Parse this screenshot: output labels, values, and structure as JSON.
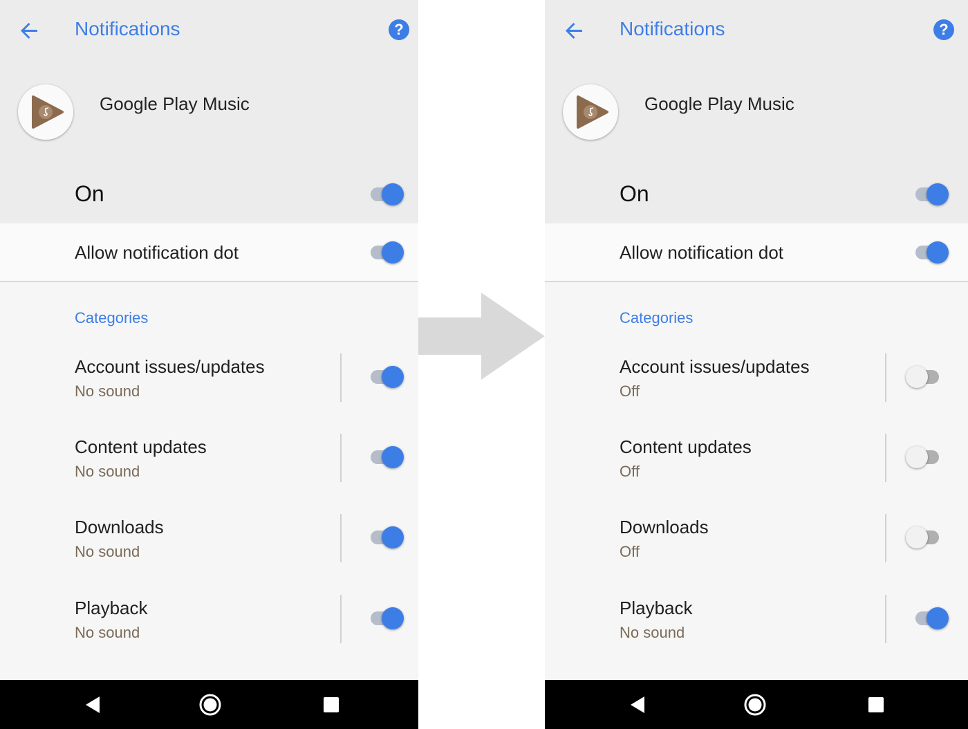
{
  "colors": {
    "accent": "#3d7de6",
    "header_bg": "#ececec",
    "subtext": "#7a6a58"
  },
  "screens": [
    {
      "title": "Notifications",
      "help_glyph": "?",
      "app_name": "Google Play Music",
      "master_label": "On",
      "master_on": true,
      "dot_label": "Allow notification dot",
      "dot_on": true,
      "categories_header": "Categories",
      "categories": [
        {
          "title": "Account issues/updates",
          "status": "No sound",
          "on": true
        },
        {
          "title": "Content updates",
          "status": "No sound",
          "on": true
        },
        {
          "title": "Downloads",
          "status": "No sound",
          "on": true
        },
        {
          "title": "Playback",
          "status": "No sound",
          "on": true
        }
      ]
    },
    {
      "title": "Notifications",
      "help_glyph": "?",
      "app_name": "Google Play Music",
      "master_label": "On",
      "master_on": true,
      "dot_label": "Allow notification dot",
      "dot_on": true,
      "categories_header": "Categories",
      "categories": [
        {
          "title": "Account issues/updates",
          "status": "Off",
          "on": false
        },
        {
          "title": "Content updates",
          "status": "Off",
          "on": false
        },
        {
          "title": "Downloads",
          "status": "Off",
          "on": false
        },
        {
          "title": "Playback",
          "status": "No sound",
          "on": true
        }
      ]
    }
  ],
  "icons": {
    "back": "arrow-back-icon",
    "help": "help-icon",
    "app": "play-music-icon",
    "nav_back": "nav-back-icon",
    "nav_home": "nav-home-icon",
    "nav_recents": "nav-recents-icon",
    "transition": "transition-arrow-icon"
  }
}
